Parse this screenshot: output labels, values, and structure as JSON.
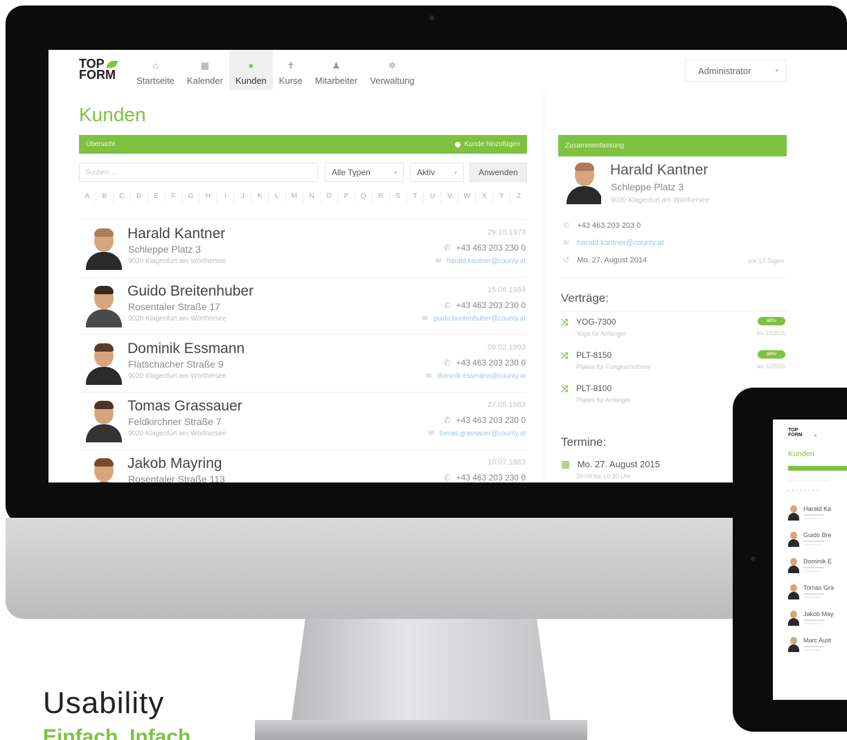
{
  "brand": {
    "logo_line1": "TOP",
    "logo_line2": "FORM",
    "accent": "#7fc241"
  },
  "nav": {
    "items": [
      {
        "label": "Startseite",
        "icon": "home-icon"
      },
      {
        "label": "Kalender",
        "icon": "calendar-icon"
      },
      {
        "label": "Kunden",
        "icon": "customers-icon",
        "active": true
      },
      {
        "label": "Kurse",
        "icon": "course-icon"
      },
      {
        "label": "Mitarbeiter",
        "icon": "user-icon"
      },
      {
        "label": "Verwaltung",
        "icon": "gear-icon"
      }
    ],
    "user_menu": "Administrator"
  },
  "page": {
    "title": "Kunden"
  },
  "overview": {
    "title": "Übersicht",
    "add_label": "Kunde hinzufügen"
  },
  "filters": {
    "search_placeholder": "Suchen ...",
    "type_select": "Alle Typen",
    "status_select": "Aktiv",
    "apply_label": "Anwenden"
  },
  "alphabet": [
    "A",
    "B",
    "C",
    "D",
    "E",
    "F",
    "G",
    "H",
    "I",
    "J",
    "K",
    "L",
    "M",
    "N",
    "O",
    "P",
    "Q",
    "R",
    "S",
    "T",
    "U",
    "V",
    "W",
    "X",
    "Y",
    "Z"
  ],
  "customers": [
    {
      "name": "Harald Kantner",
      "street": "Schleppe Platz 3",
      "city": "9020 Klagenfurt am Wörthersee",
      "date": "29.10.1973",
      "phone": "+43 463 203 230 0",
      "email": "harald.kantner@county.at"
    },
    {
      "name": "Guido Breitenhuber",
      "street": "Rosentaler Straße 17",
      "city": "9020 Klagenfurt am Wörthersee",
      "date": "15.06.1984",
      "phone": "+43 463 203 230 0",
      "email": "guido.breitenhuber@county.at"
    },
    {
      "name": "Dominik Essmann",
      "street": "Flatschacher Straße 9",
      "city": "9020 Klagenfurt am Wörthersee",
      "date": "09.02.1993",
      "phone": "+43 463 203 230 0",
      "email": "dominik.essmann@county.at"
    },
    {
      "name": "Tomas Grassauer",
      "street": "Feldkirchner Straße 7",
      "city": "9020 Klagenfurt am Wörthersee",
      "date": "27.05.1983",
      "phone": "+43 463 203 230 0",
      "email": "tomas.grassauer@county.at"
    },
    {
      "name": "Jakob Mayring",
      "street": "Rosentaler Straße 113",
      "city": "",
      "date": "10.07.1983",
      "phone": "+43 463 203 230 0",
      "email": ""
    }
  ],
  "summary": {
    "title": "Zusammenfassung",
    "name": "Harald Kantner",
    "street": "Schleppe Platz 3",
    "city": "9020 Klagenfurt am Wörthersee",
    "phone": "+43 463 203 203 0",
    "email": "harald.kantner@county.at",
    "date": "Mo. 27. August 2014",
    "ago": "vor 17 Tagen"
  },
  "contracts": {
    "heading": "Verträge:",
    "items": [
      {
        "code": "YOG-7300",
        "desc": "Yoga für Anfänger",
        "badge": "aktiv",
        "until": "bis 12/2015"
      },
      {
        "code": "PLT-8150",
        "desc": "Pilates für Fortgeschrittene",
        "badge": "aktiv",
        "until": "bis 12/2015"
      },
      {
        "code": "PLT-8100",
        "desc": "Pilates für Anfänger",
        "badge": "",
        "until": ""
      }
    ]
  },
  "appointments": {
    "heading": "Termine:",
    "items": [
      {
        "date": "Mo. 27. August 2015",
        "time": "20:00 bis 10:30 Uhr"
      }
    ]
  },
  "tablet": {
    "title": "Kunden",
    "names": [
      "Harald Ka",
      "Guido Bre",
      "Dominik E",
      "Tomas Gra",
      "Jakob May",
      "Marc Aust"
    ]
  },
  "tagline": {
    "title": "Usability",
    "subtitle": "Einfach. Infach."
  }
}
